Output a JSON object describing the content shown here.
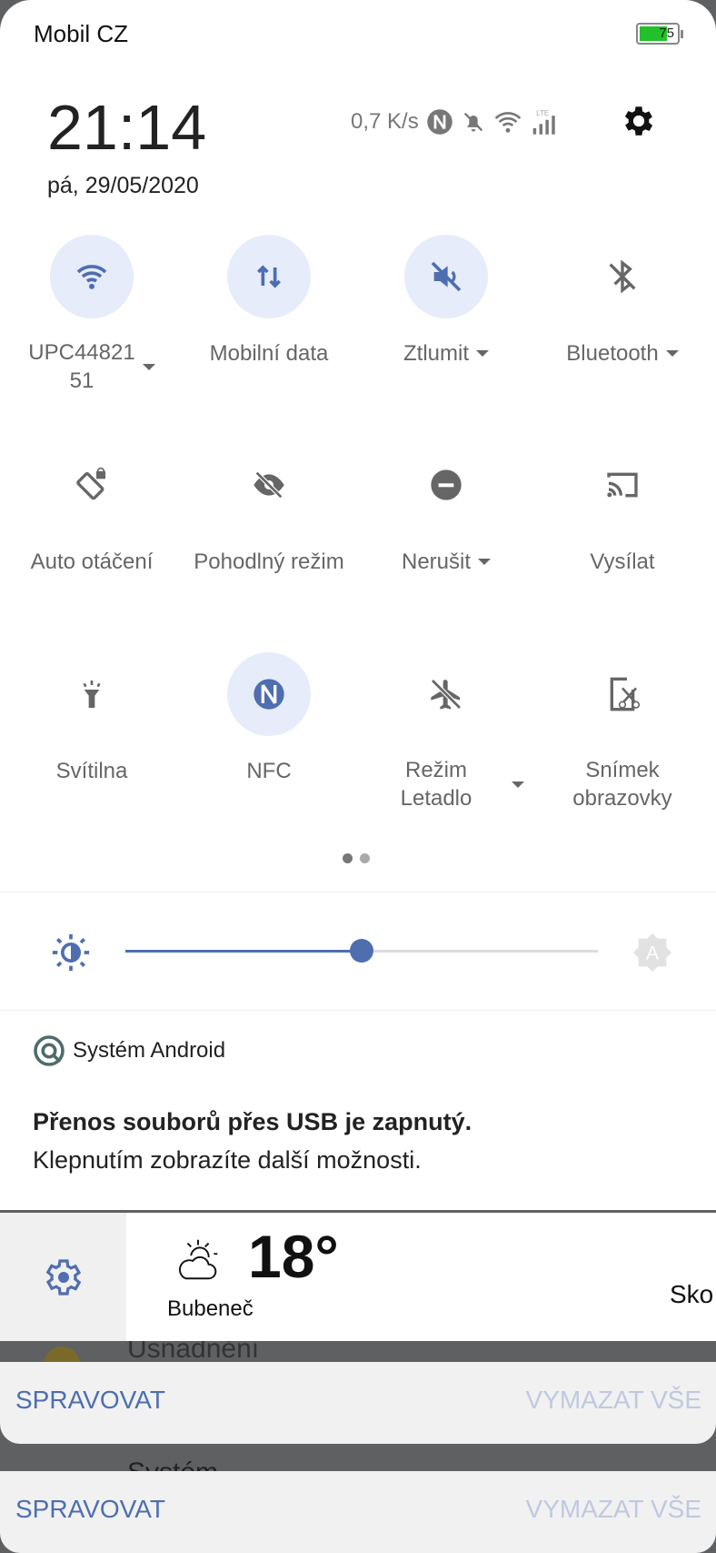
{
  "status_bar": {
    "carrier": "Mobil CZ",
    "battery": "75",
    "battery_level": 75,
    "net_speed": "0,7 K/s",
    "lte": "LTE"
  },
  "header": {
    "time": "21:14",
    "date": "pá, 29/05/2020"
  },
  "tiles": [
    {
      "label": "UPC44821\n51",
      "icon": "wifi-icon",
      "active": true,
      "dropdown": true
    },
    {
      "label": "Mobilní data",
      "icon": "mobile-data-icon",
      "active": true,
      "dropdown": false
    },
    {
      "label": "Ztlumit",
      "icon": "mute-icon",
      "active": true,
      "dropdown": true
    },
    {
      "label": "Bluetooth",
      "icon": "bluetooth-icon",
      "active": false,
      "dropdown": true
    },
    {
      "label": "Auto otáčení",
      "icon": "auto-rotate-icon",
      "active": false,
      "dropdown": false
    },
    {
      "label": "Pohodlný režim",
      "icon": "eye-comfort-icon",
      "active": false,
      "dropdown": false
    },
    {
      "label": "Nerušit",
      "icon": "do-not-disturb-icon",
      "active": false,
      "dropdown": true
    },
    {
      "label": "Vysílat",
      "icon": "cast-icon",
      "active": false,
      "dropdown": false
    },
    {
      "label": "Svítilna",
      "icon": "flashlight-icon",
      "active": false,
      "dropdown": false
    },
    {
      "label": "NFC",
      "icon": "nfc-icon",
      "active": true,
      "dropdown": false
    },
    {
      "label": "Režim Letadlo",
      "icon": "airplane-icon",
      "active": false,
      "dropdown": true
    },
    {
      "label": "Snímek obrazovky",
      "icon": "screenshot-icon",
      "active": false,
      "dropdown": false
    }
  ],
  "page_indicator": {
    "pages": 2,
    "current": 1
  },
  "brightness": {
    "level_percent": 50,
    "auto_label": "A"
  },
  "notification": {
    "app": "Systém Android",
    "title": "Přenos souborů přes USB je zapnutý.",
    "body": "Klepnutím zobrazíte další možnosti."
  },
  "weather": {
    "temp": "18°",
    "location": "Bubeneč",
    "cut_text": "Sko"
  },
  "behind": {
    "item1": "Usnadnění",
    "item2": "Systém"
  },
  "cards": [
    {
      "manage": "SPRAVOVAT",
      "clear": "VYMAZAT VŠE"
    },
    {
      "manage": "SPRAVOVAT",
      "clear": "VYMAZAT VŠE"
    }
  ],
  "colors": {
    "accent": "#4e6eb0",
    "tile_active_bg": "#e6ecfa",
    "battery": "#22c02a"
  }
}
